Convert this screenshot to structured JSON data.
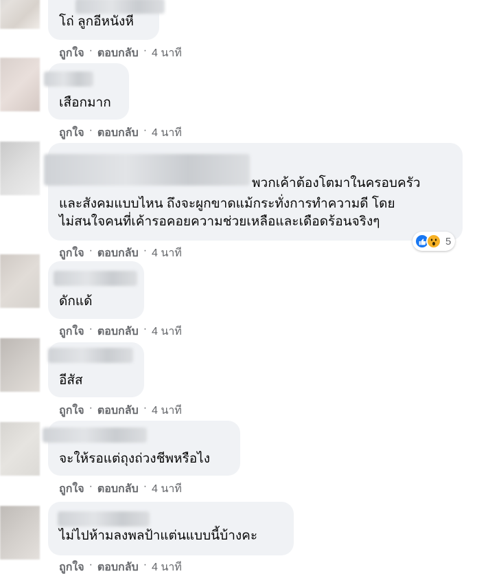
{
  "comments": [
    {
      "text_lines": [
        "โถ่ ลูกอีหนังหี"
      ],
      "like": "ถูกใจ",
      "reply": "ตอบกลับ",
      "time": "4 นาที"
    },
    {
      "text_lines": [
        "เสือกมาก"
      ],
      "like": "ถูกใจ",
      "reply": "ตอบกลับ",
      "time": "4 นาที"
    },
    {
      "text_lines": [
        "พวกเค้าต้องโตมาในครอบครัว",
        "และสังคมแบบไหน ถึงจะผูกขาดแม้กระทั่งการทำความดี โดย",
        "ไม่สนใจคนที่เค้ารอคอยความช่วยเหลือและเดือดร้อนจริงๆ"
      ],
      "like": "ถูกใจ",
      "reply": "ตอบกลับ",
      "time": "4 นาที",
      "reaction_count": "5"
    },
    {
      "text_lines": [
        "ดักแด้"
      ],
      "like": "ถูกใจ",
      "reply": "ตอบกลับ",
      "time": "4 นาที"
    },
    {
      "text_lines": [
        "อีสัส"
      ],
      "like": "ถูกใจ",
      "reply": "ตอบกลับ",
      "time": "4 นาที"
    },
    {
      "text_lines": [
        "จะให้รอแต่ถุงถ่วงชีพหรือไง"
      ],
      "like": "ถูกใจ",
      "reply": "ตอบกลับ",
      "time": "4 นาที"
    },
    {
      "text_lines": [
        "ไม่ไปห้ามลงพลป้าแต่นแบบนี้บ้างคะ"
      ],
      "like": "ถูกใจ",
      "reply": "ตอบกลับ",
      "time": "4 นาที"
    }
  ],
  "separator": "·",
  "icons": {
    "like_reaction": "thumbs-up-icon",
    "wow_reaction": "wow-face-icon"
  },
  "colors": {
    "bubble": "#f0f2f5",
    "meta_text": "#65676b",
    "like_blue": "#1877f2",
    "wow_yellow": "#f7b125"
  }
}
